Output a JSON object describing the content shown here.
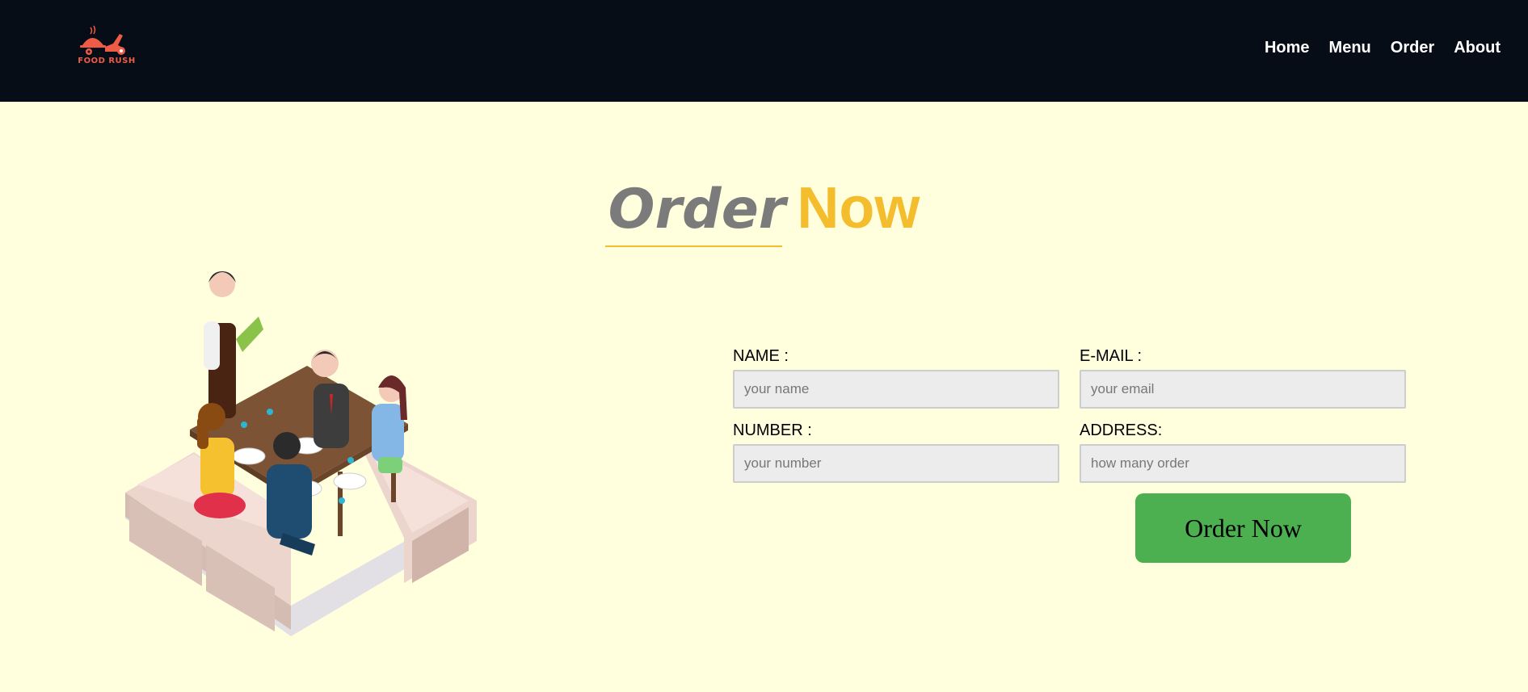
{
  "brand": {
    "name": "FOOD RUSH",
    "color": "#ef5b45"
  },
  "nav": {
    "items": [
      {
        "label": "Home"
      },
      {
        "label": "Menu"
      },
      {
        "label": "Order"
      },
      {
        "label": "About"
      }
    ]
  },
  "heading": {
    "word1": "Order",
    "word2": "Now"
  },
  "form": {
    "name": {
      "label": "NAME :",
      "placeholder": "your name",
      "value": ""
    },
    "email": {
      "label": "E-MAIL :",
      "placeholder": "your email",
      "value": ""
    },
    "number": {
      "label": "NUMBER :",
      "placeholder": "your number",
      "value": ""
    },
    "address": {
      "label": "ADDRESS:",
      "placeholder": "how many order",
      "value": ""
    },
    "submit_label": "Order Now"
  },
  "illustration": {
    "icon": "restaurant-dining-illustration"
  },
  "colors": {
    "navbar": "#070d16",
    "background": "#ffffde",
    "accent": "#f4bd2e",
    "button": "#4caf50"
  }
}
